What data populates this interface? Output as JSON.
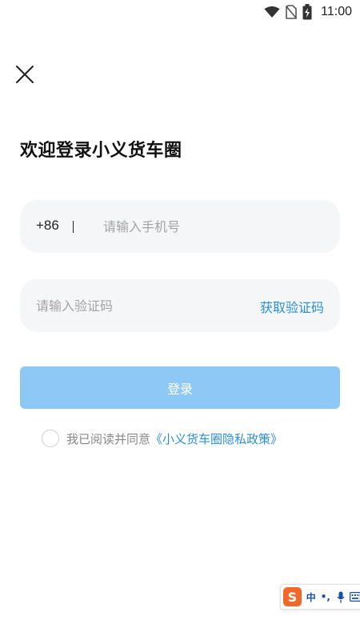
{
  "status_bar": {
    "time": "11:00",
    "icons": [
      "wifi-icon",
      "no-sim-icon",
      "battery-charging-icon"
    ]
  },
  "header": {
    "close_icon": "close-icon"
  },
  "title": "欢迎登录小义货车圈",
  "phone_field": {
    "country_code": "+86",
    "placeholder": "请输入手机号",
    "value": ""
  },
  "code_field": {
    "placeholder": "请输入验证码",
    "value": "",
    "get_code_label": "获取验证码"
  },
  "login_button": {
    "label": "登录"
  },
  "agreement": {
    "checked": false,
    "text": "我已阅读并同意",
    "link": "《小义货车圈隐私政策》"
  },
  "ime_toolbar": {
    "logo": "S",
    "lang": "中",
    "punct": "•,",
    "icons": [
      "microphone-icon",
      "keyboard-icon"
    ]
  },
  "colors": {
    "accent": "#2b8fd8",
    "button_disabled": "#8ec8f7",
    "field_bg": "#f5f6f8"
  }
}
